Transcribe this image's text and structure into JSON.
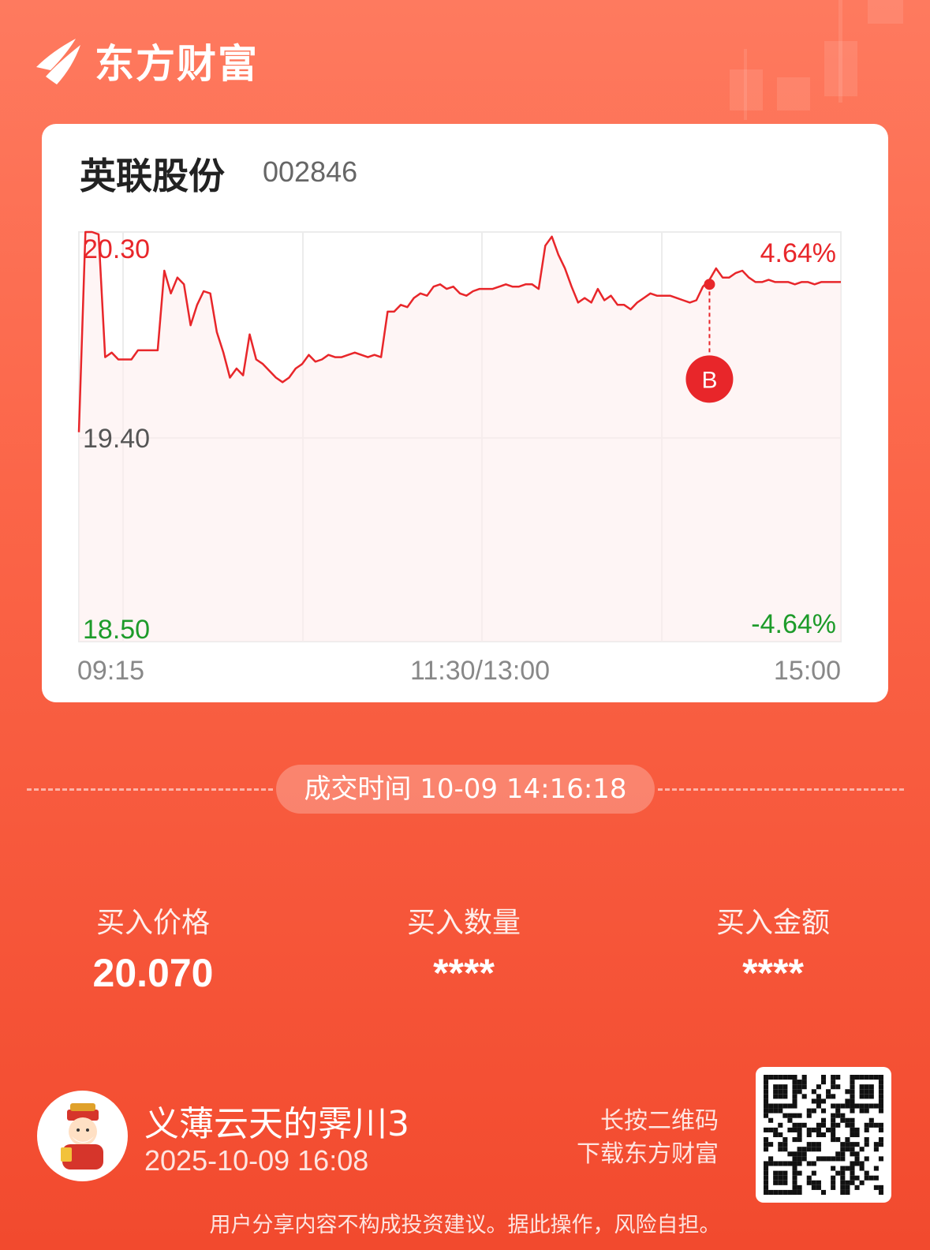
{
  "brand": {
    "name": "东方财富"
  },
  "stock": {
    "name": "英联股份",
    "code": "002846"
  },
  "chart_data": {
    "type": "line",
    "x_labels": [
      "09:15",
      "11:30/13:00",
      "15:00"
    ],
    "y_labels": {
      "high": "20.30",
      "mid": "19.40",
      "low": "18.50"
    },
    "pct_labels": {
      "high": "4.64%",
      "low": "-4.64%"
    },
    "ylim": [
      18.5,
      20.3
    ],
    "series": [
      {
        "values": [
          19.42,
          20.3,
          20.3,
          20.29,
          19.75,
          19.77,
          19.74,
          19.74,
          19.74,
          19.78,
          19.78,
          19.78,
          19.78,
          20.13,
          20.03,
          20.1,
          20.07,
          19.89,
          19.98,
          20.04,
          20.03,
          19.86,
          19.77,
          19.66,
          19.7,
          19.67,
          19.85,
          19.74,
          19.72,
          19.69,
          19.66,
          19.64,
          19.66,
          19.7,
          19.72,
          19.76,
          19.73,
          19.74,
          19.76,
          19.75,
          19.75,
          19.76,
          19.77,
          19.76,
          19.75,
          19.76,
          19.75,
          19.95,
          19.95,
          19.98,
          19.97,
          20.01,
          20.03,
          20.02,
          20.06,
          20.07,
          20.05,
          20.06,
          20.03,
          20.02,
          20.04,
          20.05,
          20.05,
          20.05,
          20.06,
          20.07,
          20.06,
          20.06,
          20.07,
          20.07,
          20.05,
          20.24,
          20.28,
          20.2,
          20.14,
          20.06,
          19.99,
          20.01,
          19.99,
          20.05,
          20.0,
          20.02,
          19.98,
          19.98,
          19.96,
          19.99,
          20.01,
          20.03,
          20.02,
          20.02,
          20.02,
          20.01,
          20.0,
          19.99,
          20.0,
          20.06,
          20.09,
          20.14,
          20.1,
          20.1,
          20.12,
          20.13,
          20.1,
          20.08,
          20.08,
          20.09,
          20.08,
          20.08,
          20.08,
          20.07,
          20.08,
          20.08,
          20.07,
          20.08,
          20.08,
          20.08,
          20.08
        ],
        "buy_marker": {
          "label": "B",
          "time": "10-09 14:16:18",
          "price": 20.07
        }
      }
    ]
  },
  "trade": {
    "time_label": "成交时间 10-09 14:16:18"
  },
  "stats": [
    {
      "title": "买入价格",
      "value": "20.070"
    },
    {
      "title": "买入数量",
      "value": "****"
    },
    {
      "title": "买入金额",
      "value": "****"
    }
  ],
  "user": {
    "name": "义薄云天的霁川3",
    "date": "2025-10-09 16:08"
  },
  "qr_hint": {
    "line1": "长按二维码",
    "line2": "下载东方财富"
  },
  "disclaimer": "用户分享内容不构成投资建议。据此操作，风险自担。",
  "colors": {
    "up": "#e8262a",
    "down": "#1d9b2a",
    "neutral": "#555555"
  }
}
